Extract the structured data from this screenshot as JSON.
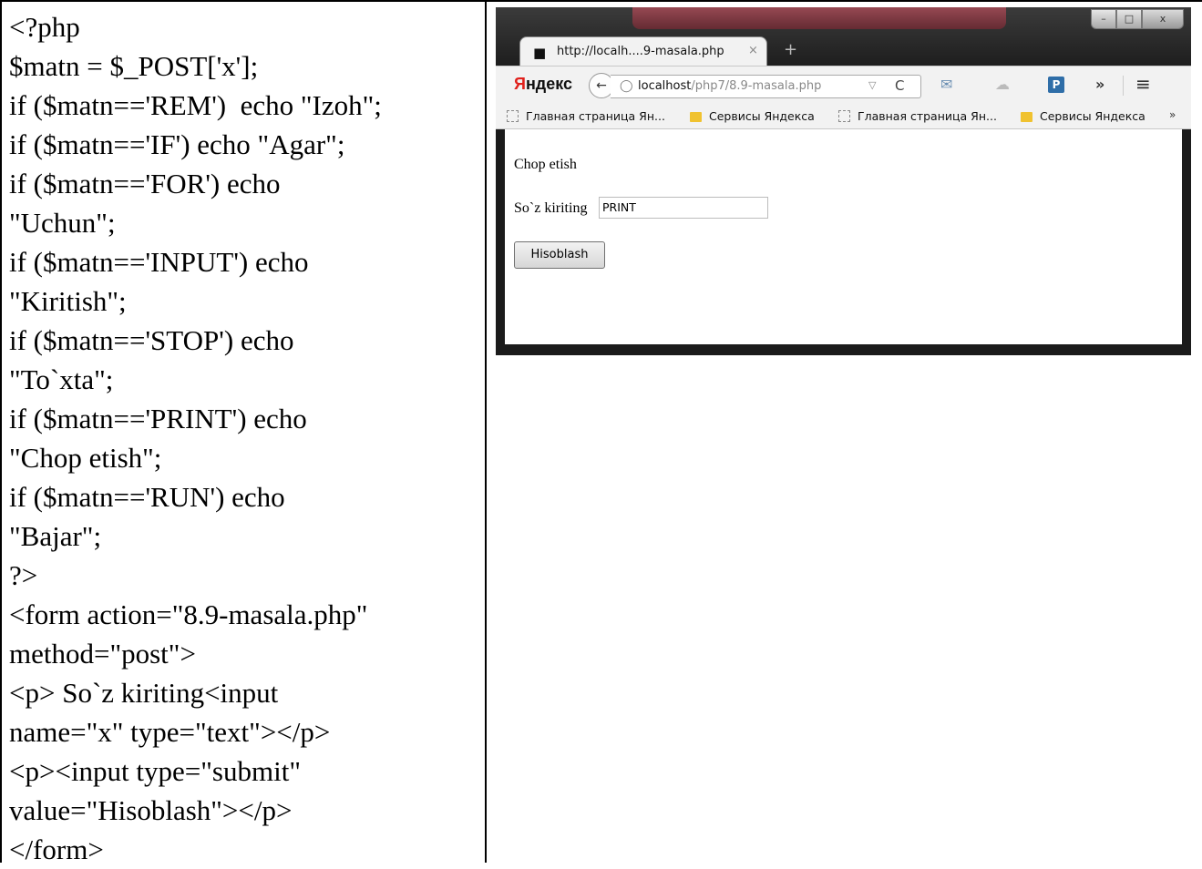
{
  "code_lines": [
    "<?php",
    "$matn = $_POST['x'];",
    "if ($matn=='REM')  echo \"Izoh\";",
    "if ($matn=='IF') echo \"Agar\";",
    "if ($matn=='FOR') echo",
    "\"Uchun\";",
    "if ($matn=='INPUT') echo",
    "\"Kiritish\";",
    "if ($matn=='STOP') echo",
    "\"To`xta\";",
    "if ($matn=='PRINT') echo",
    "\"Chop etish\";",
    "if ($matn=='RUN') echo",
    "\"Bajar\";",
    "?>",
    "<form action=\"8.9-masala.php\"",
    "method=\"post\">",
    "<p> So`z kiriting<input",
    "name=\"x\" type=\"text\"></p>",
    "<p><input type=\"submit\"",
    "value=\"Hisoblash\"></p>",
    "</form>"
  ],
  "browser": {
    "window_controls": {
      "minimize": "–",
      "maximize": "□",
      "close": "x"
    },
    "tab": {
      "icon": "incognito-icon",
      "title": "http://localh....9-masala.php",
      "close": "×"
    },
    "new_tab": "+",
    "yandex_logo_first": "Я",
    "yandex_logo_rest": "ндекс",
    "back": "←",
    "url_host": "localhost",
    "url_path": "/php7/8.9-masala.php",
    "dropdown": "▽",
    "reload": "C",
    "more": "»",
    "menu": "≡",
    "p_icon": "P",
    "bookmarks": [
      {
        "label": "Главная страница Ян...",
        "kind": "page"
      },
      {
        "label": "Сервисы Яндекса",
        "kind": "folder"
      },
      {
        "label": "Главная страница Ян...",
        "kind": "page"
      },
      {
        "label": "Сервисы Яндекса",
        "kind": "folder"
      }
    ],
    "bookmarks_more": "»"
  },
  "page": {
    "result": "Chop etish",
    "prompt": "So`z kiriting",
    "input_value": "PRINT",
    "submit": "Hisoblash"
  }
}
